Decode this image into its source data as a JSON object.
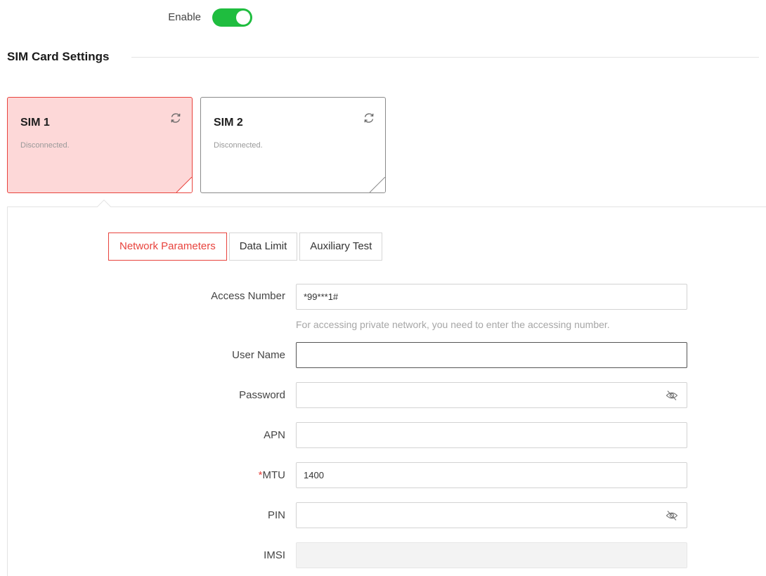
{
  "enable": {
    "label": "Enable",
    "on": true,
    "color": "#1fbd3f"
  },
  "section": {
    "title": "SIM Card Settings"
  },
  "sims": [
    {
      "name": "SIM 1",
      "status": "Disconnected.",
      "selected": true
    },
    {
      "name": "SIM 2",
      "status": "Disconnected.",
      "selected": false
    }
  ],
  "tabs": [
    {
      "label": "Network Parameters",
      "active": true
    },
    {
      "label": "Data Limit",
      "active": false
    },
    {
      "label": "Auxiliary Test",
      "active": false
    }
  ],
  "form": {
    "access_number": {
      "label": "Access Number",
      "value": "*99***1#",
      "hint": "For accessing private network, you need to enter the accessing number."
    },
    "user_name": {
      "label": "User Name",
      "value": ""
    },
    "password": {
      "label": "Password",
      "value": ""
    },
    "apn": {
      "label": "APN",
      "value": ""
    },
    "mtu": {
      "label": "MTU",
      "required_mark": "*",
      "value": "1400"
    },
    "pin": {
      "label": "PIN",
      "value": ""
    },
    "imsi": {
      "label": "IMSI",
      "value": ""
    }
  },
  "colors": {
    "accent": "#e8433d",
    "active_card_bg": "#fdd8d8",
    "toggle_on": "#1fbd3f"
  }
}
